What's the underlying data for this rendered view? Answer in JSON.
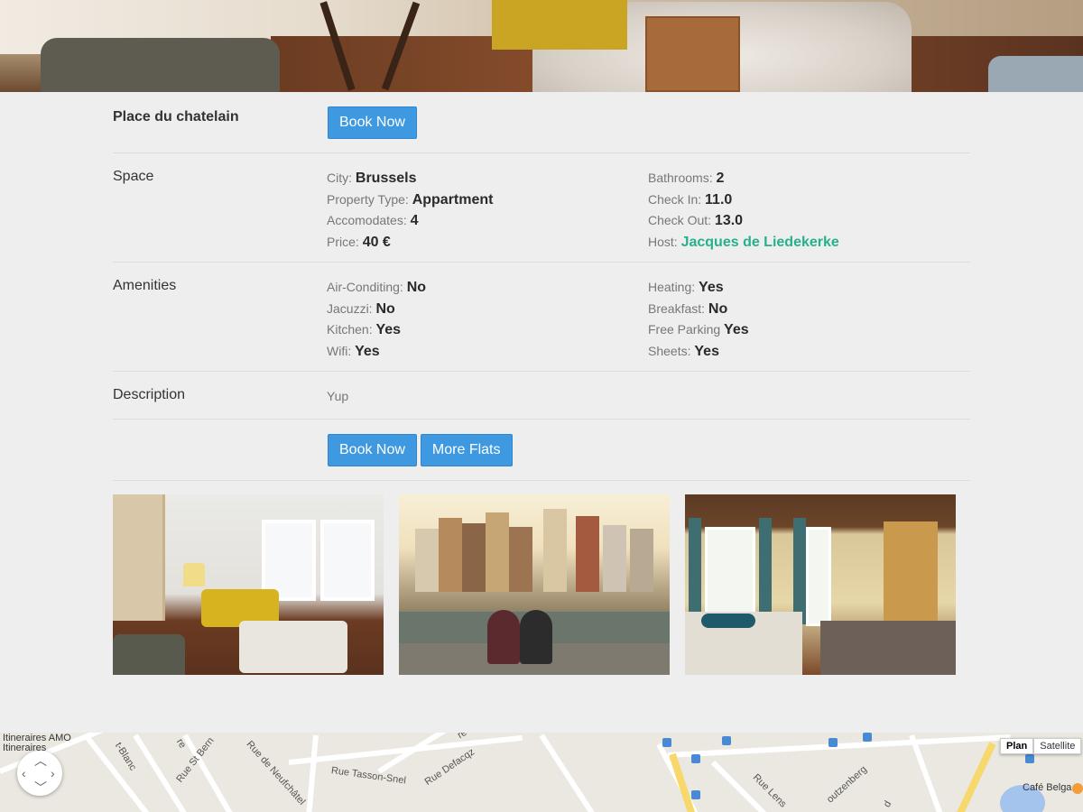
{
  "listing": {
    "name": "Place du chatelain",
    "book_label": "Book Now"
  },
  "space": {
    "label": "Space",
    "left": [
      {
        "key": "City:",
        "value": "Brussels"
      },
      {
        "key": "Property Type:",
        "value": "Appartment"
      },
      {
        "key": "Accomodates:",
        "value": "4"
      },
      {
        "key": "Price:",
        "value": "40 €"
      }
    ],
    "right": [
      {
        "key": "Bathrooms:",
        "value": "2"
      },
      {
        "key": "Check In:",
        "value": "11.0"
      },
      {
        "key": "Check Out:",
        "value": "13.0"
      },
      {
        "key": "Host:",
        "value": "Jacques de Liedekerke"
      }
    ]
  },
  "amenities": {
    "label": "Amenities",
    "left": [
      {
        "key": "Air-Conditing:",
        "value": "No"
      },
      {
        "key": "Jacuzzi:",
        "value": "No"
      },
      {
        "key": "Kitchen:",
        "value": "Yes"
      },
      {
        "key": "Wifi:",
        "value": "Yes"
      }
    ],
    "right": [
      {
        "key": "Heating:",
        "value": "Yes"
      },
      {
        "key": "Breakfast:",
        "value": "No"
      },
      {
        "key": "Free Parking",
        "value": "Yes"
      },
      {
        "key": "Sheets:",
        "value": "Yes"
      }
    ]
  },
  "description": {
    "label": "Description",
    "value": "Yup"
  },
  "actions": {
    "book_label": "Book Now",
    "more_label": "More Flats"
  },
  "map": {
    "type_plan": "Plan",
    "type_satellite": "Satellite",
    "labels": {
      "itineraries_1": "Itineraires AMO",
      "itineraries_2": "Itineraires",
      "blanc": "t-Blanc",
      "st_bern": "Rue St Bern",
      "neufchatel": "Rue de Neufchâtel",
      "re": "re",
      "tasson": "Rue Tasson-Snel",
      "defacqz": "Rue Defacqz",
      "lens": "Rue Lens",
      "putzenberg": "outzenberg",
      "d": "d",
      "cafe": "Café Belga"
    }
  },
  "colors": {
    "primary_button": "#3e99e0",
    "host_link": "#27b08e",
    "background": "#eeeeee"
  }
}
